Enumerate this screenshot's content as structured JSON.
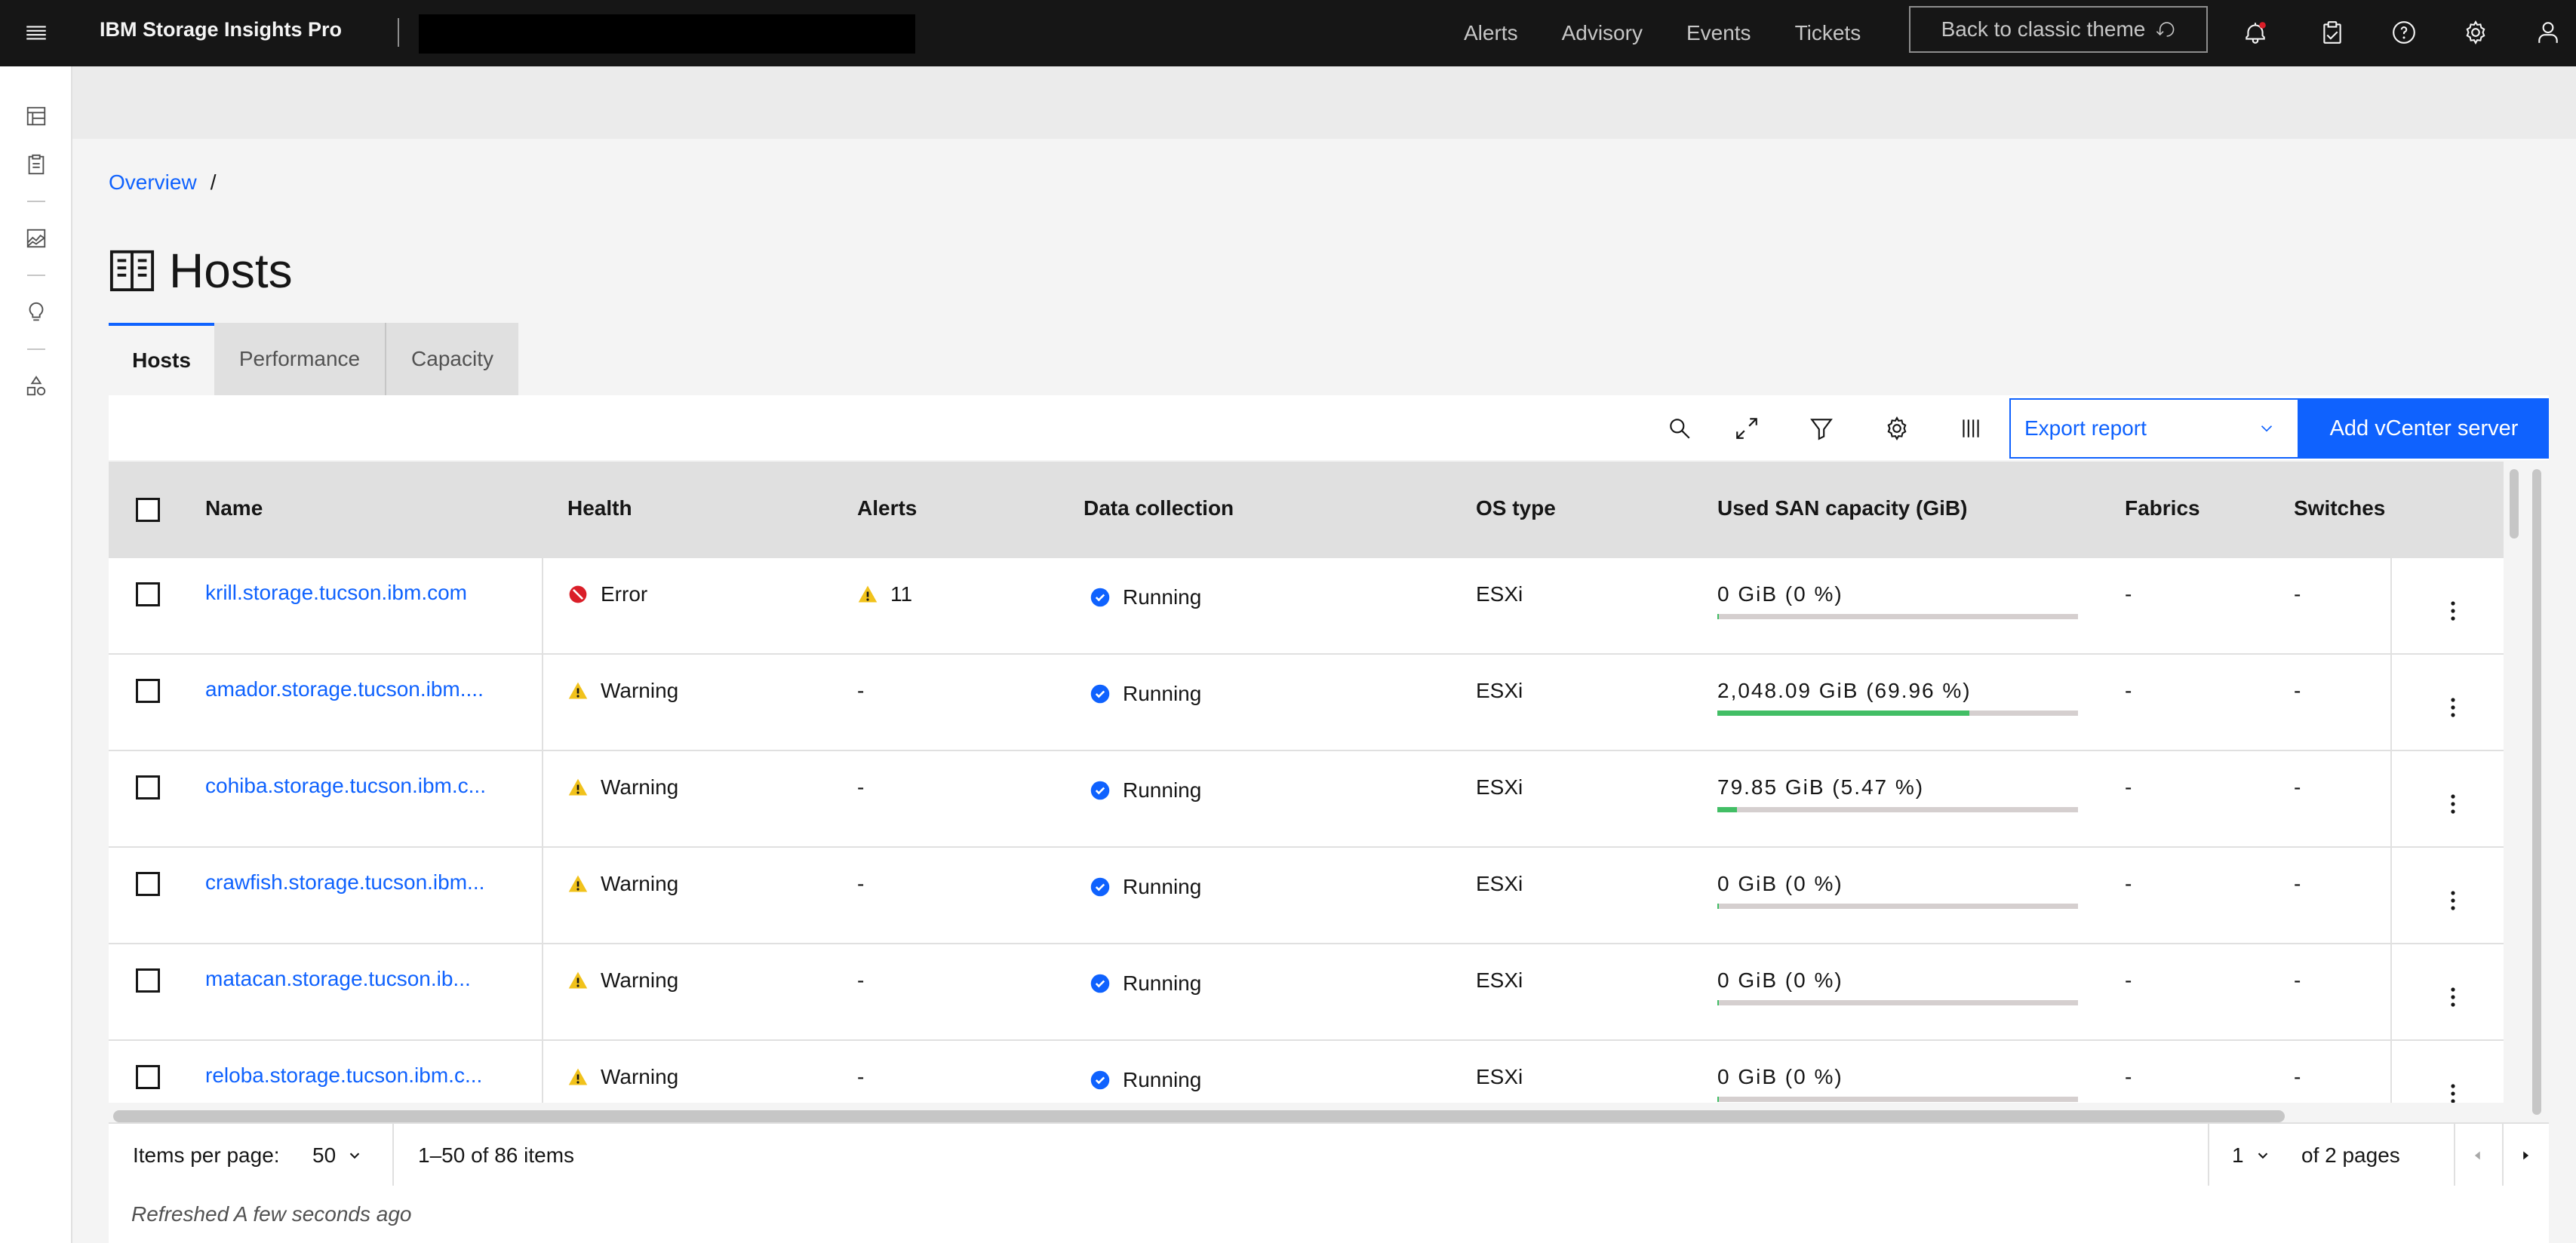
{
  "header": {
    "product": "IBM Storage Insights Pro",
    "nav": [
      "Alerts",
      "Advisory",
      "Events",
      "Tickets"
    ],
    "classic_button": "Back to classic theme",
    "icons": [
      "notification-icon",
      "clipboard-icon",
      "help-icon",
      "settings-icon",
      "user-icon"
    ]
  },
  "breadcrumb": {
    "overview": "Overview",
    "sep": "/"
  },
  "page": {
    "title": "Hosts"
  },
  "tabs": [
    "Hosts",
    "Performance",
    "Capacity"
  ],
  "toolbar": {
    "export_label": "Export report",
    "add_label": "Add vCenter server"
  },
  "table": {
    "columns": [
      "Name",
      "Health",
      "Alerts",
      "Data collection",
      "OS type",
      "Used SAN capacity (GiB)",
      "Fabrics",
      "Switches"
    ],
    "rows": [
      {
        "name": "krill.storage.tucson.ibm.com",
        "health": "Error",
        "alerts": "11",
        "collection": "Running",
        "os": "ESXi",
        "capacity": "0 GiB (0 %)",
        "fraction": 0.0,
        "fabrics": "-",
        "switches": "-"
      },
      {
        "name": "amador.storage.tucson.ibm....",
        "health": "Warning",
        "alerts": "-",
        "collection": "Running",
        "os": "ESXi",
        "capacity": "2,048.09 GiB (69.96 %)",
        "fraction": 0.6996,
        "fabrics": "-",
        "switches": "-"
      },
      {
        "name": "cohiba.storage.tucson.ibm.c...",
        "health": "Warning",
        "alerts": "-",
        "collection": "Running",
        "os": "ESXi",
        "capacity": "79.85 GiB (5.47 %)",
        "fraction": 0.0547,
        "fabrics": "-",
        "switches": "-"
      },
      {
        "name": "crawfish.storage.tucson.ibm...",
        "health": "Warning",
        "alerts": "-",
        "collection": "Running",
        "os": "ESXi",
        "capacity": "0 GiB (0 %)",
        "fraction": 0.0,
        "fabrics": "-",
        "switches": "-"
      },
      {
        "name": "matacan.storage.tucson.ib...",
        "health": "Warning",
        "alerts": "-",
        "collection": "Running",
        "os": "ESXi",
        "capacity": "0 GiB (0 %)",
        "fraction": 0.0,
        "fabrics": "-",
        "switches": "-"
      },
      {
        "name": "reloba.storage.tucson.ibm.c...",
        "health": "Warning",
        "alerts": "-",
        "collection": "Running",
        "os": "ESXi",
        "capacity": "0 GiB (0 %)",
        "fraction": 0.0,
        "fabrics": "-",
        "switches": "-"
      }
    ]
  },
  "pagination": {
    "items_per_page_label": "Items per page:",
    "items_per_page": "50",
    "range": "1–50 of 86 items",
    "page": "1",
    "of_pages": "of 2 pages"
  },
  "refreshed": "Refreshed A few seconds ago",
  "colors": {
    "brand": "#0f62fe",
    "error": "#da1e28",
    "warning": "#f1c21b",
    "success_bar": "#42be65"
  }
}
